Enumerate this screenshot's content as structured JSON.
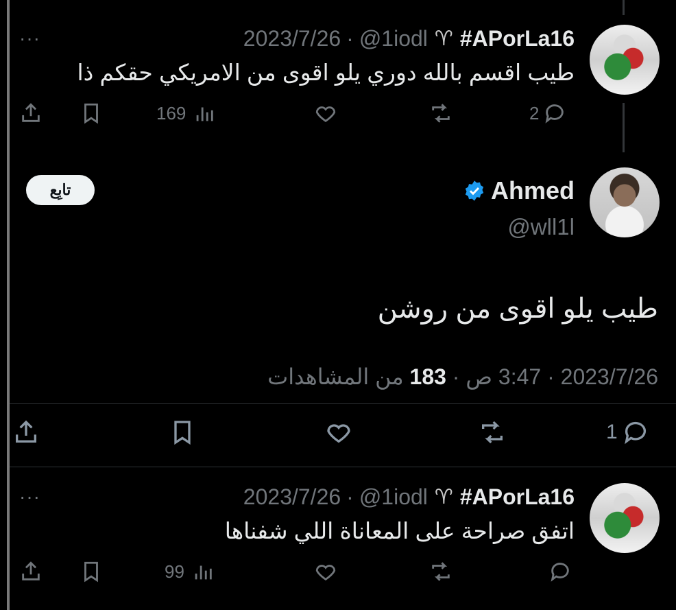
{
  "reply1": {
    "name": "#APorLa16",
    "handle": "@1iodl",
    "date": "2023/7/26",
    "text": "طيب اقسم بالله دوري يلو اقوى من الامريكي حقكم ذا",
    "replies": "2",
    "views": "169"
  },
  "main": {
    "name": "Ahmed",
    "handle": "@wll1l",
    "follow_label": "تابِع",
    "text": "طيب يلو اقوى من روشن",
    "date": "2023/7/26",
    "time": "3:47 ص",
    "views_count": "183",
    "views_label": "من المشاهدات",
    "replies": "1"
  },
  "reply2": {
    "name": "#APorLa16",
    "handle": "@1iodl",
    "date": "2023/7/26",
    "text": "اتفق صراحة على المعاناة اللي شفناها",
    "views": "99"
  },
  "separator_dot": "·",
  "more_glyph": "···",
  "colors": {
    "background": "#000000",
    "text": "#e7e9ea",
    "muted": "#71767b",
    "verified": "#1d9bf0"
  },
  "icons": [
    "share-icon",
    "bookmark-icon",
    "views-icon",
    "like-icon",
    "retweet-icon",
    "reply-icon",
    "verified-icon",
    "goat-icon",
    "more-icon"
  ]
}
